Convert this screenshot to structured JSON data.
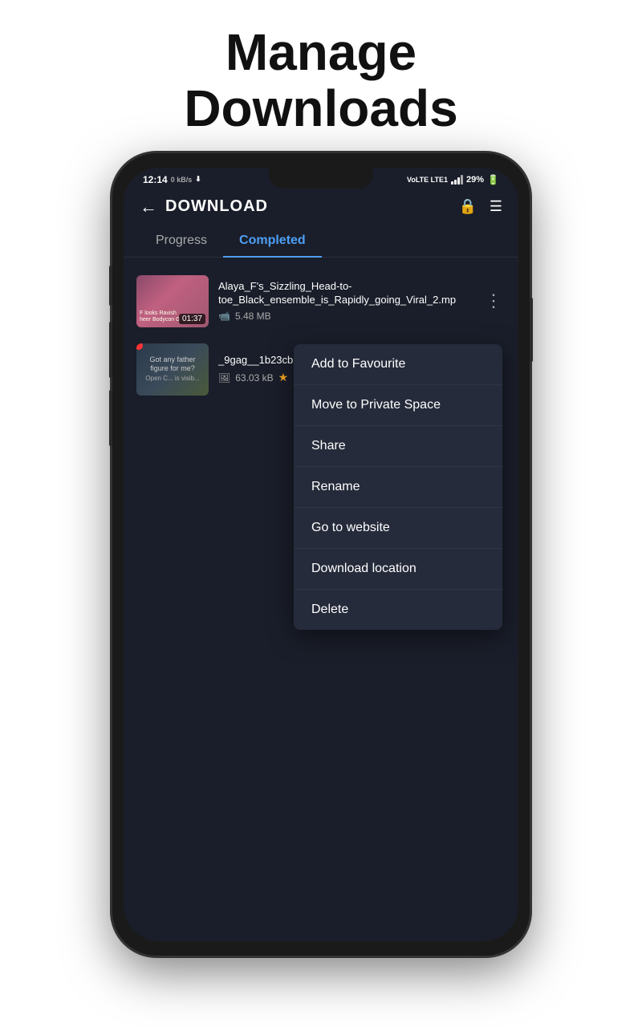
{
  "header": {
    "title": "Manage Downloads",
    "line1": "Manage",
    "line2": "Downloads"
  },
  "statusBar": {
    "time": "12:14",
    "network": "0 kB/s",
    "network_type": "VoLTE LTE1",
    "signal": "●●●",
    "battery": "29%"
  },
  "toolbar": {
    "back_label": "←",
    "title": "DOWNLOAD"
  },
  "tabs": [
    {
      "label": "Progress",
      "active": false
    },
    {
      "label": "Completed",
      "active": true
    }
  ],
  "downloadItems": [
    {
      "name": "Alaya_F's_Sizzling_Head-to-toe_Black_ensemble_is_Rapidly_going_Viral_2.mp",
      "size": "5.48 MB",
      "duration": "01:37",
      "type": "video",
      "starred": false
    },
    {
      "name": "_9gag__1b23cb5d84488fec2.jpg",
      "size": "63.03 kB",
      "duration": null,
      "type": "image",
      "starred": true
    }
  ],
  "contextMenu": {
    "items": [
      {
        "label": "Add to Favourite"
      },
      {
        "label": "Move to Private Space"
      },
      {
        "label": "Share"
      },
      {
        "label": "Rename"
      },
      {
        "label": "Go to website"
      },
      {
        "label": "Download location"
      },
      {
        "label": "Delete"
      }
    ]
  },
  "colors": {
    "active_tab": "#4d9ff5",
    "background": "#1a1e2a",
    "star": "#f5a623",
    "red_dot": "#ff3333"
  }
}
